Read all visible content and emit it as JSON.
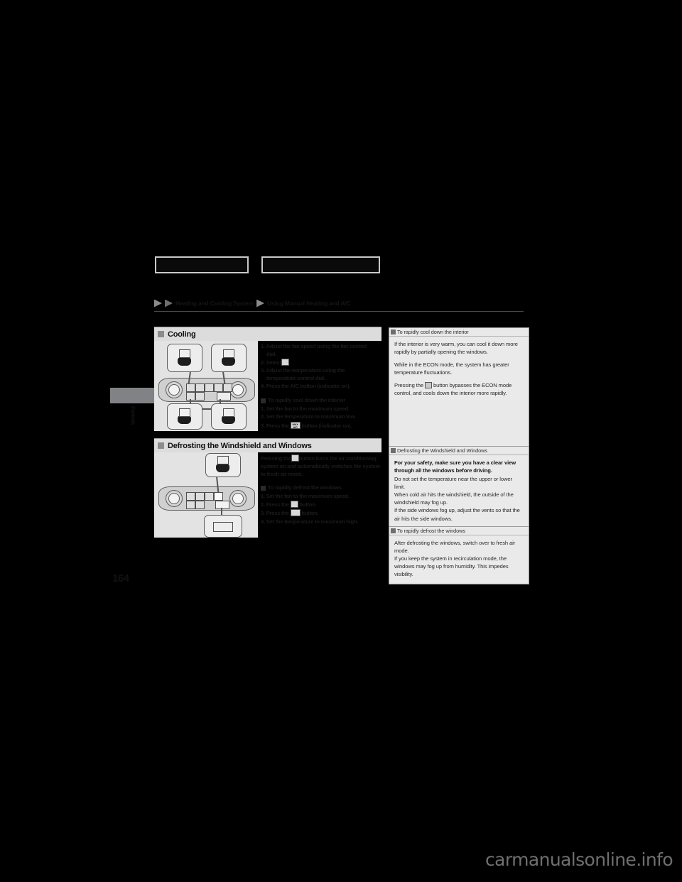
{
  "page": {
    "number": "164",
    "chapter_tab": "Controls",
    "watermark": "carmanualsonline.info",
    "header_box_1": "",
    "header_box_2": ""
  },
  "breadcrumb": {
    "part1": "Heating and Cooling System",
    "part2": "Using Manual Heating and A/C"
  },
  "sections": [
    {
      "id": "cooling",
      "title": "Cooling",
      "steps": [
        {
          "n": "1.",
          "text": "Adjust the fan speed using the fan control",
          "cont": "dial."
        },
        {
          "n": "2.",
          "text": "Select",
          "icon": "vent-face-icon",
          "tail": "."
        },
        {
          "n": "3.",
          "text": "Adjust the temperature using the",
          "cont": "temperature control dial."
        },
        {
          "n": "4.",
          "text": "Press the A/C button (indicator on)."
        }
      ],
      "subsection": {
        "title": "To rapidly cool down the interior",
        "steps": [
          {
            "n": "1.",
            "text": "Set the fan to the maximum speed."
          },
          {
            "n": "2.",
            "text": "Set the temperature to maximum low."
          },
          {
            "n": "3.",
            "text": "Press the",
            "icon": "MAX A/C",
            "tail": "button (indicator on)."
          }
        ]
      },
      "figure": "climate-control-panel-cooling-diagram"
    },
    {
      "id": "defrosting",
      "title": "Defrosting the Windshield and Windows",
      "paragraph_lines": [
        "Pressing the",
        "button turns the air",
        "conditioning system on and automatically",
        "switches the system to fresh air mode."
      ],
      "paragraph_icon": "front-defroster-icon",
      "subsection": {
        "title": "To rapidly defrost the windows",
        "steps": [
          {
            "n": "1.",
            "text": "Set the fan to the maximum speed."
          },
          {
            "n": "2.",
            "text": "Press the",
            "icon": "front-defroster-icon",
            "tail": "button."
          },
          {
            "n": "3.",
            "text": "Press the",
            "icon": "fresh-air-icon",
            "tail": "button."
          },
          {
            "n": "4.",
            "text": "Set the temperature to maximum high."
          }
        ]
      },
      "figure": "climate-control-panel-defrost-diagram"
    }
  ],
  "sidebar": [
    {
      "id": "rapid-cool",
      "heading": "To rapidly cool down the interior",
      "paragraphs": [
        {
          "bold": false,
          "text": "If the interior is very warm, you can cool it down more rapidly by partially opening the windows."
        },
        {
          "bold": false,
          "text": "While in the ECON mode, the system has greater temperature fluctuations."
        },
        {
          "bold": false,
          "pre": "Pressing the",
          "icon": "MAX A/C",
          "text": "button bypasses the ECON mode control, and cools down the interior more rapidly."
        }
      ]
    },
    {
      "id": "defrosting-note",
      "heading": "Defrosting the Windshield and Windows",
      "paragraphs": [
        {
          "bold": true,
          "text": "For your safety, make sure you have a clear view through all the windows before driving."
        },
        {
          "bold": false,
          "text": "Do not set the temperature near the upper or lower limit."
        },
        {
          "bold": false,
          "text": "When cold air hits the windshield, the outside of the windshield may fog up."
        },
        {
          "bold": false,
          "text": "If the side windows fog up, adjust the vents so that the air hits the side windows."
        }
      ]
    },
    {
      "id": "rapid-defrost",
      "heading": "To rapidly defrost the windows",
      "paragraphs": [
        {
          "bold": false,
          "text": "After defrosting the windows, switch over to fresh air mode."
        },
        {
          "bold": false,
          "text": "If you keep the system in recirculation mode, the windows may fog up from humidity. This impedes visibility."
        }
      ]
    }
  ],
  "colors": {
    "page_bg": "#000000",
    "section_head_bg": "#dcdcdc",
    "figure_bg": "#e3e3e3",
    "sidebar_bg": "#eaeaea",
    "tab_gray": "#808285",
    "watermark": "#6f6f6f"
  }
}
